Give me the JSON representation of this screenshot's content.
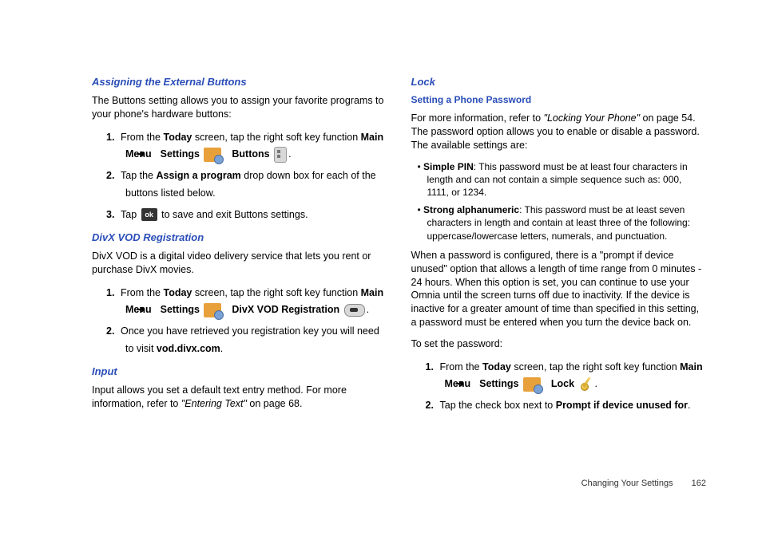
{
  "left": {
    "h1": "Assigning the External Buttons",
    "p1": "The Buttons setting allows you to assign your favorite programs to your phone's hardware buttons:",
    "steps1": {
      "s1a": "From the ",
      "s1_today": "Today",
      "s1b": " screen, tap the right soft key function ",
      "s1_mm": "Main Menu",
      "s1_settings": "Settings",
      "s1_buttons": "Buttons",
      "s2a": "Tap the ",
      "s2_assign": "Assign a program",
      "s2b": " drop down box for each of the buttons listed below.",
      "s3a": "Tap ",
      "s3_ok": "ok",
      "s3b": " to save and exit Buttons settings."
    },
    "h2": "DivX VOD Registration",
    "p2": "DivX VOD is a digital video delivery service that lets you rent or purchase DivX movies.",
    "steps2": {
      "s1a": "From the ",
      "s1_today": "Today",
      "s1b": " screen, tap the right soft key function ",
      "s1_mm": "Main Menu",
      "s1_settings": "Settings",
      "s1_divx": "DivX VOD Registration",
      "s2a": "Once you have retrieved you registration key you will need to visit ",
      "s2_url": "vod.divx.com",
      "s2b": "."
    },
    "h3": "Input",
    "p3a": "Input allows you set a default text entry method.  For more information, refer to ",
    "p3_ref": "\"Entering Text\"",
    "p3b": "  on page 68."
  },
  "right": {
    "h1": "Lock",
    "h2": "Setting a Phone Password",
    "p1a": "For more information, refer to ",
    "p1_ref": "\"Locking Your Phone\"",
    "p1b": "  on page 54. The password option allows you to enable or disable a password. The available settings are:",
    "bullets": {
      "b1_label": "Simple PIN",
      "b1_text": ": This password must be at least four characters in length and can not contain a simple sequence such as: 000, 1111, or 1234.",
      "b2_label": "Strong alphanumeric",
      "b2_text": ": This password must be at least seven characters in length and contain at least three of the following: uppercase/lowercase letters, numerals, and punctuation."
    },
    "p2": "When a password is configured, there is a \"prompt if device unused\" option that allows a length of time range from 0 minutes - 24 hours. When this option is set, you can continue to use your Omnia until the screen turns off due to inactivity. If the device is inactive for a greater amount of time than specified in this setting, a password must be entered when you turn the device back on.",
    "p3": "To set the password:",
    "steps": {
      "s1a": "From the ",
      "s1_today": "Today",
      "s1b": " screen, tap the right soft key function ",
      "s1_mm": "Main Menu",
      "s1_settings": "Settings",
      "s1_lock": "Lock",
      "s2a": "Tap the check box next to ",
      "s2_prompt": "Prompt if device unused for",
      "s2b": "."
    }
  },
  "footer": {
    "section": "Changing Your Settings",
    "page": "162"
  },
  "nums": {
    "n1": "1.",
    "n2": "2.",
    "n3": "3."
  },
  "arrow": "➔"
}
